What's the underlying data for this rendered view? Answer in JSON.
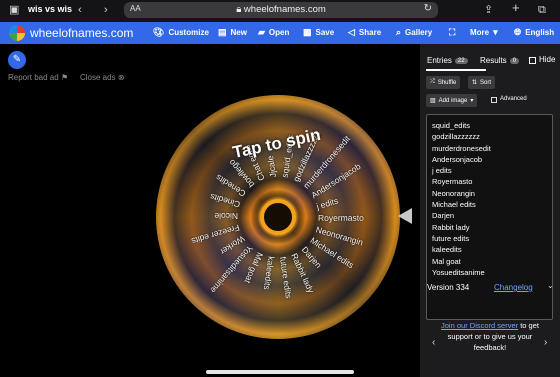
{
  "browser": {
    "tab_title": "wis vs wis",
    "url": "wheelofnames.com",
    "aa_label": "AA",
    "icons": {
      "sidebar": "sidebar-icon",
      "back": "chevron-left-icon",
      "forward": "chevron-right-icon",
      "lock": "lock-icon",
      "reload": "reload-icon",
      "share": "share-icon",
      "new_tab": "plus-icon",
      "tabs": "tabs-icon"
    }
  },
  "appbar": {
    "brand": "wheelofnames.com",
    "customize": "Customize",
    "new": "New",
    "open": "Open",
    "save": "Save",
    "share": "Share",
    "gallery": "Gallery",
    "more": "More",
    "language": "English",
    "accent_color": "#3369e8"
  },
  "left": {
    "report_bad_ad": "Report bad ad",
    "close_ads": "Close ads",
    "tap_to_spin": "Tap to spin"
  },
  "wheel": {
    "labels": [
      "squid_edits",
      "godzillazzzzzz",
      "murderdronesedit",
      "Andersonjacob",
      "j edits",
      "Royermasto",
      "Neonorangin",
      "Michael edits",
      "Darjen",
      "Rabbit lady",
      "future edits",
      "kaleedits",
      "Mal goat",
      "Yosueditsanime",
      "Worker",
      "Freezer edits",
      "Nicole",
      "Cinedits",
      "Cenedits",
      "bowllego",
      "Chat edits",
      "Jjcale"
    ]
  },
  "panel": {
    "entries_tab": "Entries",
    "entries_count": "22",
    "results_tab": "Results",
    "results_count": "0",
    "hide_label": "Hide",
    "shuffle": "Shuffle",
    "sort": "Sort",
    "add_image": "Add image",
    "advanced": "Advanced",
    "entries": [
      "squid_edits",
      "godzillazzzzzz",
      "murderdronesedit",
      "Andersonjacob",
      "j edits",
      "Royermasto",
      "Neonorangin",
      "Michael edits",
      "Darjen",
      "Rabbit lady",
      "future edits",
      "kaleedits",
      "Mal goat",
      "Yosueditsanime"
    ],
    "version": "Version 334",
    "changelog": "Changelog",
    "discord_link": "Join our Discord server",
    "discord_rest": "to get support or to give us your feedback!"
  }
}
